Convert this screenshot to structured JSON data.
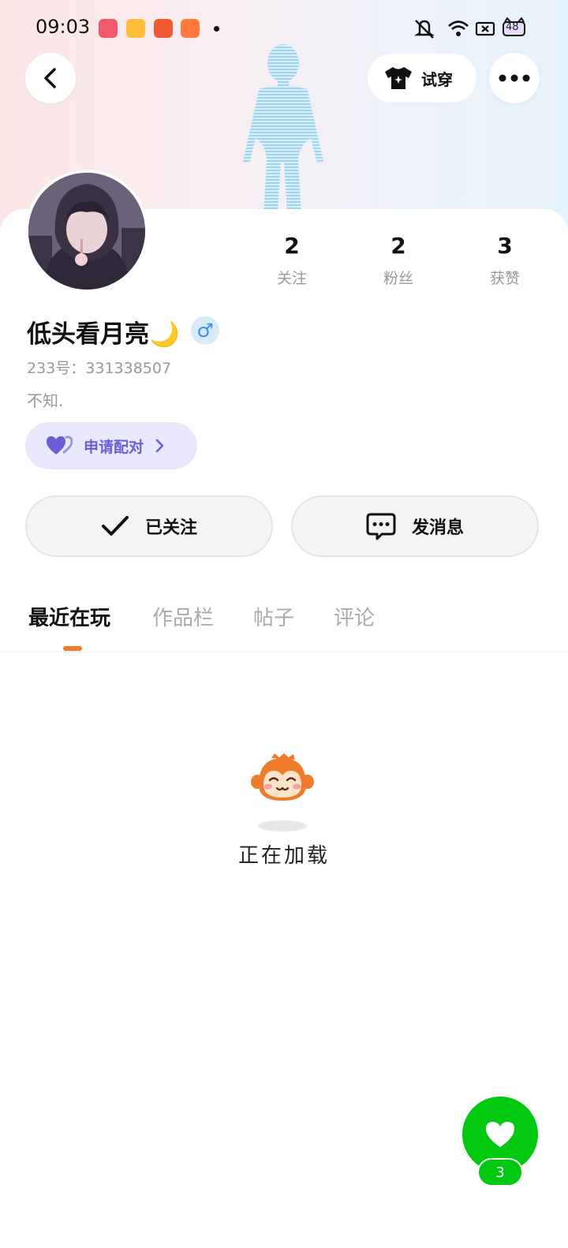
{
  "status_bar": {
    "time": "09:03",
    "battery_level": "48",
    "icons": [
      "app-icon-1",
      "app-icon-2",
      "app-icon-3",
      "app-icon-4",
      "notification-dot",
      "mute-icon",
      "wifi-icon",
      "close-box-icon",
      "battery-icon"
    ]
  },
  "header": {
    "back_icon": "chevron-left-icon",
    "try_on_label": "试穿",
    "more_icon": "ellipsis-icon"
  },
  "profile": {
    "stats": [
      {
        "value": "2",
        "label": "关注"
      },
      {
        "value": "2",
        "label": "粉丝"
      },
      {
        "value": "3",
        "label": "获赞"
      }
    ],
    "nickname": "低头看月亮🌙",
    "gender_symbol": "♂",
    "uid": "233号：331338507",
    "bio": "不知."
  },
  "pair_button": {
    "label": "申请配对"
  },
  "actions": {
    "follow_label": "已关注",
    "message_label": "发消息"
  },
  "tabs": [
    {
      "label": "最近在玩",
      "active": true
    },
    {
      "label": "作品栏",
      "active": false
    },
    {
      "label": "帖子",
      "active": false
    },
    {
      "label": "评论",
      "active": false
    }
  ],
  "loading": {
    "text": "正在加载"
  },
  "like_fab": {
    "count": "3"
  },
  "colors": {
    "accent_orange": "#f07b2a",
    "pair_purple": "#6a5fd7",
    "like_green": "#00c90f",
    "gender_blue": "#3a8ee6"
  }
}
